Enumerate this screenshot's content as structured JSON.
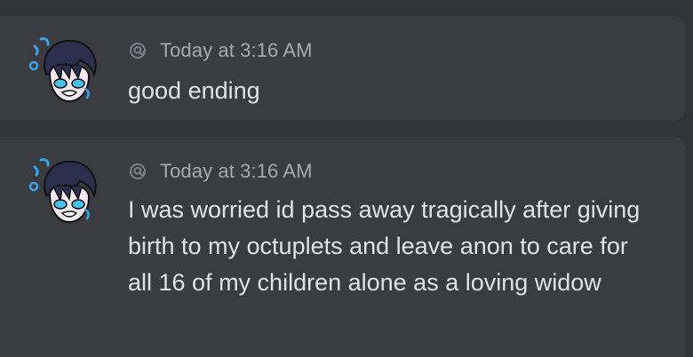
{
  "messages": [
    {
      "author_icon": "anonymous-at-icon",
      "timestamp": "Today at 3:16 AM",
      "text": "good ending"
    },
    {
      "author_icon": "anonymous-at-icon",
      "timestamp": "Today at 3:16 AM",
      "text": "I was worried id pass away tragically after giving birth to my octuplets and leave anon to care for all 16 of my children alone as a loving widow"
    }
  ],
  "colors": {
    "background": "#313338",
    "message_bg": "#3a3c42",
    "text": "#e1e2e5",
    "timestamp": "#a7a9b0",
    "accent_blue": "#39a7e0"
  }
}
